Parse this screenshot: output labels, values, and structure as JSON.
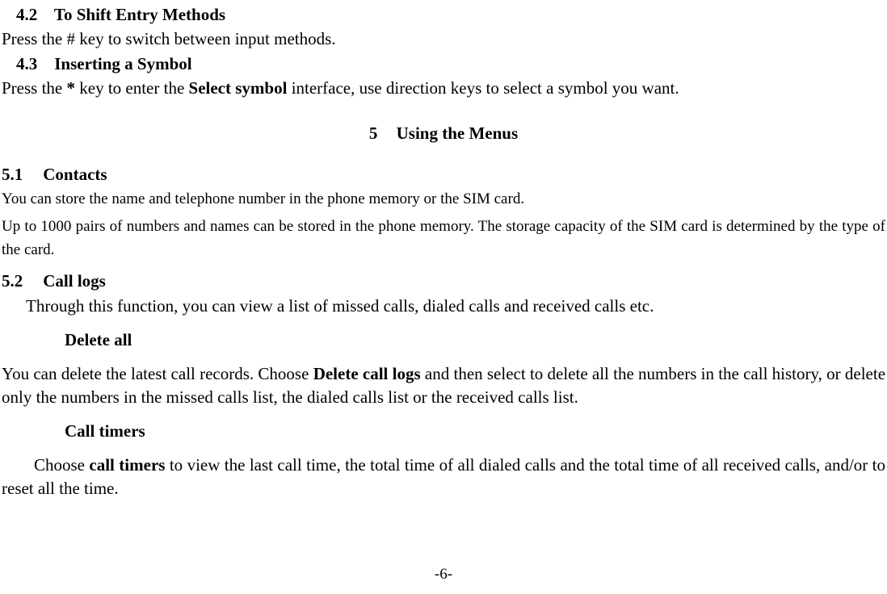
{
  "s42": {
    "num": "4.2",
    "title": "To Shift Entry Methods",
    "body": "Press the # key to switch between input methods."
  },
  "s43": {
    "num": "4.3",
    "title": "Inserting a Symbol",
    "body_pre": "Press the ",
    "body_key": "*",
    "body_mid": " key to enter the ",
    "body_bold": "Select symbol",
    "body_post": " interface, use direction keys to select a symbol you want."
  },
  "h5": {
    "num": "5",
    "title": "Using the Menus"
  },
  "s51": {
    "num": "5.1",
    "title": "Contacts",
    "p1": "You can store the name and telephone number in the phone memory or the SIM card.",
    "p2": "Up to 1000 pairs of numbers and names can be stored in the phone memory. The storage capacity of the SIM card is determined by the type of the card."
  },
  "s52": {
    "num": "5.2",
    "title": "Call logs",
    "intro": "Through this function, you can view a list of missed calls, dialed calls and received calls etc.",
    "delall": {
      "title": "Delete all",
      "p_pre": "You can delete the latest call records. Choose ",
      "p_bold": "Delete call logs",
      "p_post": " and then select to delete all the numbers in the call history, or delete only the numbers in the missed calls list, the dialed calls list or the received calls list."
    },
    "timers": {
      "title": "Call timers",
      "p_pre": "Choose ",
      "p_bold": "call timers",
      "p_post": " to view the last call time, the total time of all dialed calls and the total time of all received calls, and/or to reset all the time."
    }
  },
  "footer": "-6-"
}
